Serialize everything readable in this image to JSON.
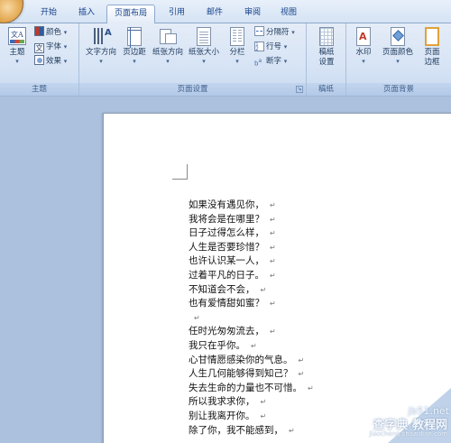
{
  "tabs": [
    {
      "label": "开始",
      "active": false
    },
    {
      "label": "插入",
      "active": false
    },
    {
      "label": "页面布局",
      "active": true
    },
    {
      "label": "引用",
      "active": false
    },
    {
      "label": "邮件",
      "active": false
    },
    {
      "label": "审阅",
      "active": false
    },
    {
      "label": "视图",
      "active": false
    }
  ],
  "ribbon": {
    "theme_group": {
      "label": "主题",
      "themes_button": "主题",
      "colors": "颜色",
      "fonts": "字体",
      "effects": "效果"
    },
    "page_setup_group": {
      "label": "页面设置",
      "text_direction": "文字方向",
      "margins": "页边距",
      "orientation": "纸张方向",
      "size": "纸张大小",
      "columns": "分栏",
      "breaks": "分隔符",
      "line_numbers": "行号",
      "hyphenation": "断字"
    },
    "manuscript_group": {
      "label": "稿纸",
      "manuscript_setup_line1": "稿纸",
      "manuscript_setup_line2": "设置"
    },
    "page_background_group": {
      "label": "页面背景",
      "watermark": "水印",
      "page_color": "页面颜色",
      "page_borders_line1": "页面",
      "page_borders_line2": "边框"
    }
  },
  "document": {
    "lines": [
      "如果没有遇见你，",
      "我将会是在哪里？",
      "日子过得怎么样，",
      "人生是否要珍惜？",
      "也许认识某一人，",
      "过着平凡的日子。",
      "不知道会不会，",
      "也有爱情甜如蜜？",
      "",
      "任时光匆匆流去，",
      "我只在乎你。",
      "心甘情愿感染你的气息。",
      "人生几何能够得到知己？",
      "失去生命的力量也不可惜。",
      "所以我求求你，",
      "别让我离开你。",
      "除了你，我不能感到，"
    ],
    "paragraph_mark": "↵"
  },
  "watermark": {
    "site": "jb51.net",
    "main": "查字典 教程网",
    "sub": "jiaocheng.chazidian.com"
  }
}
